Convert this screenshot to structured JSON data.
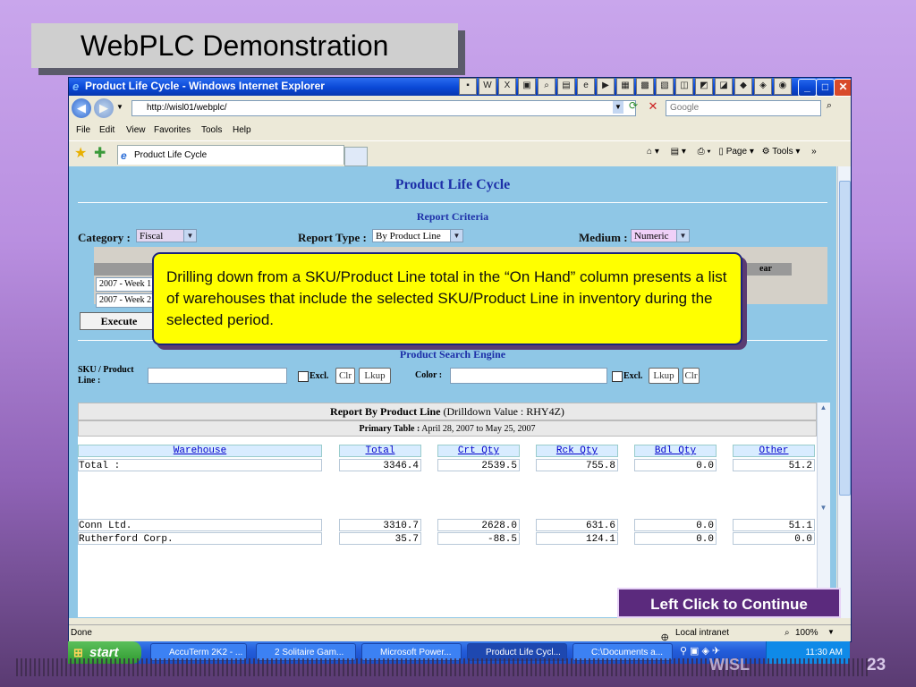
{
  "slide": {
    "title": "WebPLC Demonstration",
    "number": "23",
    "logo_text": "WISL"
  },
  "window": {
    "title": "Product Life Cycle - Windows Internet Explorer",
    "minimize": "_",
    "maximize": "□",
    "close": "✕"
  },
  "address_bar": {
    "url": "http://wisl01/webplc/",
    "search_placeholder": "Google"
  },
  "menu": [
    "File",
    "Edit",
    "View",
    "Favorites",
    "Tools",
    "Help"
  ],
  "tab": {
    "label": "Product Life Cycle"
  },
  "command_bar": {
    "page": "Page",
    "tools": "Tools"
  },
  "page": {
    "title": "Product Life Cycle",
    "criteria_heading": "Report Criteria",
    "category_label": "Category :",
    "category_value": "Fiscal",
    "report_type_label": "Report Type :",
    "report_type_value": "By Product Line",
    "medium_label": "Medium :",
    "medium_value": "Numeric",
    "period_partial_header": "ear",
    "week_from": "2007 - Week 1",
    "week_to": "2007 - Week 2",
    "execute_label": "Execute",
    "search_heading": "Product Search Engine",
    "sku_label": "SKU / Product Line :",
    "excl_label": "Excl.",
    "clr_label": "Clr",
    "lkup_label": "Lkup",
    "color_label": "Color :"
  },
  "report": {
    "title": "Report By Product Line",
    "drilldown": "(Drilldown Value : RHY4Z)",
    "primary_label": "Primary Table :",
    "primary_range": "April 28, 2007 to May 25, 2007",
    "columns": [
      "Warehouse",
      "Total",
      "Crt Qty",
      "Rck Qty",
      "Bdl Qty",
      "Other"
    ],
    "total_row": [
      "Total :",
      "3346.4",
      "2539.5",
      "755.8",
      "0.0",
      "51.2"
    ],
    "rows": [
      [
        "Conn Ltd.",
        "3310.7",
        "2628.0",
        "631.6",
        "0.0",
        "51.1"
      ],
      [
        "Rutherford Corp.",
        "35.7",
        "-88.5",
        "124.1",
        "0.0",
        "0.0"
      ]
    ]
  },
  "status_bar": {
    "left": "Done",
    "zone": "Local intranet",
    "zoom": "100%"
  },
  "callout": {
    "text": "Drilling down from a SKU/Product Line total in the “On Hand” column presents a list of warehouses that include the selected SKU/Product Line in inventory during the selected period."
  },
  "continue_button": {
    "label": "Left Click to Continue"
  },
  "taskbar": {
    "start": "start",
    "tasks": [
      "AccuTerm 2K2 - ...",
      "2 Solitaire Gam...",
      "Microsoft Power...",
      "Product Life Cycl...",
      "C:\\Documents a..."
    ],
    "clock": "11:30 AM"
  }
}
